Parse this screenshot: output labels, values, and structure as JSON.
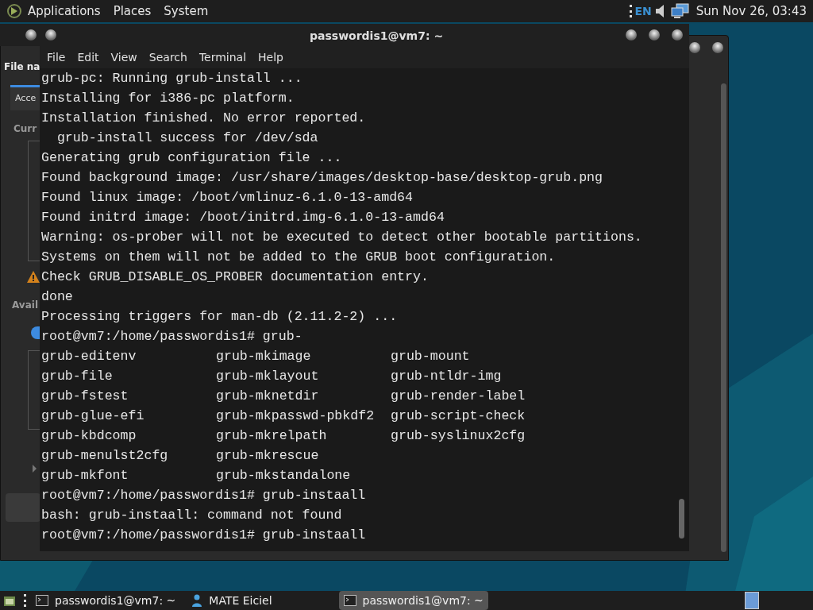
{
  "top_panel": {
    "menus": [
      "Applications",
      "Places",
      "System"
    ],
    "keyboard_layout": "EN",
    "clock": "Sun Nov 26, 03:43"
  },
  "background_window": {
    "file_label": "File na",
    "tab": "Acce",
    "section_1": "Curr",
    "section_2": "Avail",
    "radio_selected": true
  },
  "terminal": {
    "title": "passwordis1@vm7: ~",
    "menu": [
      "File",
      "Edit",
      "View",
      "Search",
      "Terminal",
      "Help"
    ],
    "lines": [
      {
        "kind": "text",
        "text": "grub-pc: Running grub-install ..."
      },
      {
        "kind": "text",
        "text": "Installing for i386-pc platform."
      },
      {
        "kind": "text",
        "text": "Installation finished. No error reported."
      },
      {
        "kind": "text",
        "text": "  grub-install success for /dev/sda"
      },
      {
        "kind": "text",
        "text": "Generating grub configuration file ..."
      },
      {
        "kind": "text",
        "text": "Found background image: /usr/share/images/desktop-base/desktop-grub.png"
      },
      {
        "kind": "text",
        "text": "Found linux image: /boot/vmlinuz-6.1.0-13-amd64"
      },
      {
        "kind": "text",
        "text": "Found initrd image: /boot/initrd.img-6.1.0-13-amd64"
      },
      {
        "kind": "text",
        "text": "Warning: os-prober will not be executed to detect other bootable partitions."
      },
      {
        "kind": "text",
        "text": "Systems on them will not be added to the GRUB boot configuration."
      },
      {
        "kind": "text",
        "text": "Check GRUB_DISABLE_OS_PROBER documentation entry."
      },
      {
        "kind": "text",
        "text": "done"
      },
      {
        "kind": "text",
        "text": "Processing triggers for man-db (2.11.2-2) ..."
      },
      {
        "kind": "text",
        "text": "root@vm7:/home/passwordis1# grub-"
      },
      {
        "kind": "columns",
        "cells": [
          "grub-editenv",
          "grub-mkimage",
          "grub-mount"
        ]
      },
      {
        "kind": "columns",
        "cells": [
          "grub-file",
          "grub-mklayout",
          "grub-ntldr-img"
        ]
      },
      {
        "kind": "columns",
        "cells": [
          "grub-fstest",
          "grub-mknetdir",
          "grub-render-label"
        ]
      },
      {
        "kind": "columns",
        "cells": [
          "grub-glue-efi",
          "grub-mkpasswd-pbkdf2",
          "grub-script-check"
        ]
      },
      {
        "kind": "columns",
        "cells": [
          "grub-kbdcomp",
          "grub-mkrelpath",
          "grub-syslinux2cfg"
        ]
      },
      {
        "kind": "columns",
        "cells": [
          "grub-menulst2cfg",
          "grub-mkrescue"
        ]
      },
      {
        "kind": "columns",
        "cells": [
          "grub-mkfont",
          "grub-mkstandalone"
        ]
      },
      {
        "kind": "text",
        "text": "root@vm7:/home/passwordis1# grub-instaall"
      },
      {
        "kind": "text",
        "text": "bash: grub-instaall: command not found"
      },
      {
        "kind": "text",
        "text": "root@vm7:/home/passwordis1# grub-instaall"
      }
    ]
  },
  "taskbar": {
    "items": [
      {
        "kind": "terminal",
        "label": "passwordis1@vm7: ~",
        "selected": false
      },
      {
        "kind": "person",
        "label": "MATE Eiciel",
        "selected": false
      },
      {
        "kind": "terminal",
        "label": "passwordis1@vm7: ~",
        "selected": true
      }
    ]
  }
}
